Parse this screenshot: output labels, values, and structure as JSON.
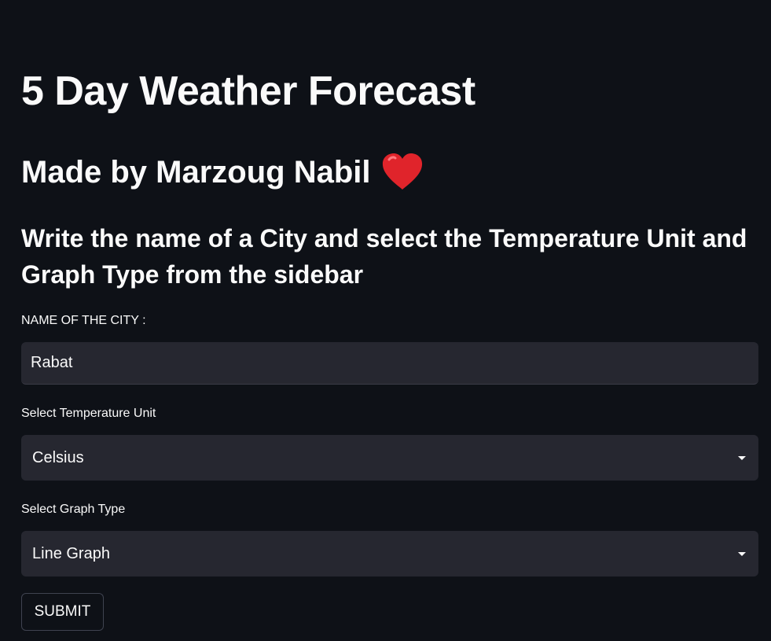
{
  "page": {
    "title": "5 Day Weather Forecast",
    "subtitle": "Made by Marzoug Nabil",
    "subtitle_icon": "red-heart-emoji",
    "instructions": "Write the name of a City and select the Temperature Unit and Graph Type from the sidebar"
  },
  "form": {
    "city_label": "NAME OF THE CITY :",
    "city_value": "Rabat",
    "unit_label": "Select Temperature Unit",
    "unit_selected": "Celsius",
    "graph_label": "Select Graph Type",
    "graph_selected": "Line Graph",
    "submit_label": "SUBMIT"
  },
  "colors": {
    "background": "#0e1117",
    "input_background": "#262730",
    "text": "#fafafa",
    "heart": "#e0242b"
  }
}
